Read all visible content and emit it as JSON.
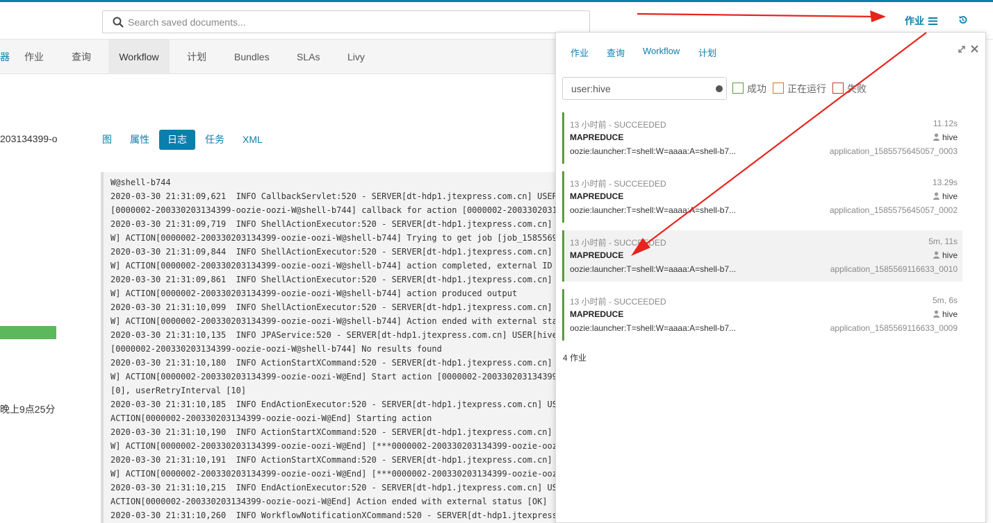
{
  "header": {
    "search_placeholder": "Search saved documents...",
    "jobs_label": "作业"
  },
  "nav": {
    "stub_label": "器",
    "items": [
      "作业",
      "查询",
      "Workflow",
      "计划",
      "Bundles",
      "SLAs",
      "Livy"
    ],
    "active": "Workflow"
  },
  "job_detail": {
    "id_fragment": "203134399-o",
    "progress_percent": 100,
    "time_fragment": "晚上9点25分",
    "tabs": [
      "图",
      "属性",
      "日志",
      "任务",
      "XML"
    ],
    "active_tab": "日志"
  },
  "log_lines": [
    "W@shell-b744",
    "2020-03-30 21:31:09,621  INFO CallbackServlet:520 - SERVER[dt-hdp1.jtexpress.com.cn] USER",
    "[0000002-200330203134399-oozie-oozi-W@shell-b744] callback for action [0000002-2003302031",
    "2020-03-30 21:31:09,719  INFO ShellActionExecutor:520 - SERVER[dt-hdp1.jtexpress.com.cn]",
    "W] ACTION[0000002-200330203134399-oozie-oozi-W@shell-b744] Trying to get job [job_1585569",
    "2020-03-30 21:31:09,844  INFO ShellActionExecutor:520 - SERVER[dt-hdp1.jtexpress.com.cn]",
    "W] ACTION[0000002-200330203134399-oozie-oozi-W@shell-b744] action completed, external ID",
    "2020-03-30 21:31:09,861  INFO ShellActionExecutor:520 - SERVER[dt-hdp1.jtexpress.com.cn]",
    "W] ACTION[0000002-200330203134399-oozie-oozi-W@shell-b744] action produced output",
    "2020-03-30 21:31:10,099  INFO ShellActionExecutor:520 - SERVER[dt-hdp1.jtexpress.com.cn]",
    "W] ACTION[0000002-200330203134399-oozie-oozi-W@shell-b744] Action ended with external sta",
    "2020-03-30 21:31:10,135  INFO JPAService:520 - SERVER[dt-hdp1.jtexpress.com.cn] USER[hive",
    "[0000002-200330203134399-oozie-oozi-W@shell-b744] No results found",
    "2020-03-30 21:31:10,180  INFO ActionStartXCommand:520 - SERVER[dt-hdp1.jtexpress.com.cn]",
    "W] ACTION[0000002-200330203134399-oozie-oozi-W@End] Start action [0000002-200330203134399",
    "[0], userRetryInterval [10]",
    "2020-03-30 21:31:10,185  INFO EndActionExecutor:520 - SERVER[dt-hdp1.jtexpress.com.cn] US",
    "ACTION[0000002-200330203134399-oozie-oozi-W@End] Starting action",
    "2020-03-30 21:31:10,190  INFO ActionStartXCommand:520 - SERVER[dt-hdp1.jtexpress.com.cn]",
    "W] ACTION[0000002-200330203134399-oozie-oozi-W@End] [***0000002-200330203134399-oozie-ooz",
    "2020-03-30 21:31:10,191  INFO ActionStartXCommand:520 - SERVER[dt-hdp1.jtexpress.com.cn]",
    "W] ACTION[0000002-200330203134399-oozie-oozi-W@End] [***0000002-200330203134399-oozie-ooz",
    "2020-03-30 21:31:10,215  INFO EndActionExecutor:520 - SERVER[dt-hdp1.jtexpress.com.cn] US",
    "ACTION[0000002-200330203134399-oozie-oozi-W@End] Action ended with external status [OK]",
    "2020-03-30 21:31:10,260  INFO WorkflowNotificationXCommand:520 - SERVER[dt-hdp1.jtexpress"
  ],
  "panel": {
    "tabs": [
      "作业",
      "查询",
      "Workflow",
      "计划"
    ],
    "filter_value": "user:hive",
    "filters": [
      {
        "label": "成功",
        "color": "#5a9a3d"
      },
      {
        "label": "正在运行",
        "color": "#c8792a"
      },
      {
        "label": "失败",
        "color": "#c0392b"
      }
    ],
    "jobs": [
      {
        "time_status": "13 小时前 - SUCCEEDED",
        "duration": "11.12s",
        "type": "MAPREDUCE",
        "user": "hive",
        "name": "oozie:launcher:T=shell:W=aaaa:A=shell-b7...",
        "app_id": "application_1585575645057_0003"
      },
      {
        "time_status": "13 小时前 - SUCCEEDED",
        "duration": "13.29s",
        "type": "MAPREDUCE",
        "user": "hive",
        "name": "oozie:launcher:T=shell:W=aaaa:A=shell-b7...",
        "app_id": "application_1585575645057_0002"
      },
      {
        "time_status": "13 小时前 - SUCCEEDED",
        "duration": "5m, 11s",
        "type": "MAPREDUCE",
        "user": "hive",
        "name": "oozie:launcher:T=shell:W=aaaa:A=shell-b7...",
        "app_id": "application_1585569116633_0010"
      },
      {
        "time_status": "13 小时前 - SUCCEEDED",
        "duration": "5m, 6s",
        "type": "MAPREDUCE",
        "user": "hive",
        "name": "oozie:launcher:T=shell:W=aaaa:A=shell-b7...",
        "app_id": "application_1585569116633_0009"
      }
    ],
    "count_label": "4 作业"
  },
  "colors": {
    "accent": "#0b7fab",
    "success": "#5cb85c",
    "annotation_arrow": "#e8231c"
  }
}
